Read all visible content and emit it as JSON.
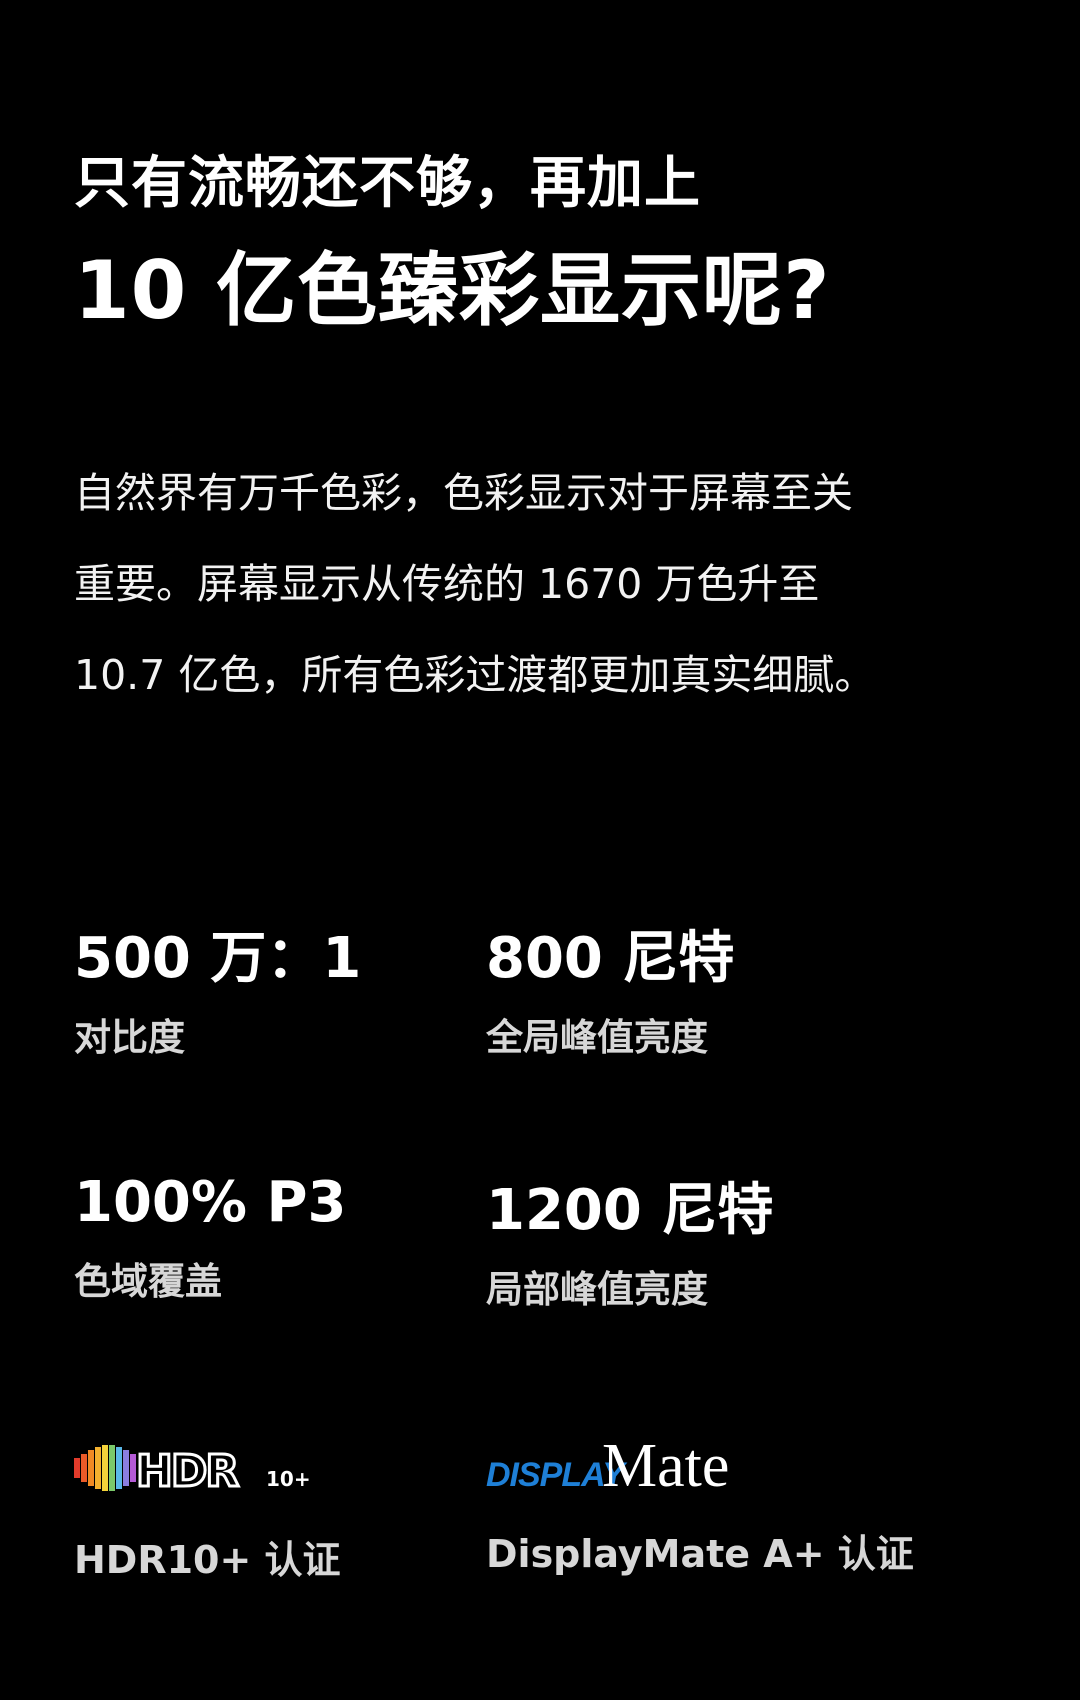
{
  "headline": {
    "line1": "只有流畅还不够，再加上",
    "line2": "10 亿色臻彩显示呢?"
  },
  "body_lines": [
    "自然界有万千色彩，色彩显示对于屏幕至关",
    "重要。屏幕显示从传统的 1670 万色升至",
    "10.7 亿色，所有色彩过渡都更加真实细腻。"
  ],
  "specs": [
    {
      "value": "500 万：1",
      "label": "对比度"
    },
    {
      "value": "800 尼特",
      "label": "全局峰值亮度"
    },
    {
      "value": "100% P3",
      "label": "色域覆盖"
    },
    {
      "value": "1200 尼特",
      "label": "局部峰值亮度"
    }
  ],
  "certifications": [
    {
      "logo_text": "HDR",
      "logo_suffix": "10+",
      "label": "HDR10+ 认证",
      "logo_icon": "hdr10plus-logo"
    },
    {
      "logo_text_blue": "DISPLAY",
      "logo_text_white": "Mate",
      "label": "DisplayMate A+ 认证",
      "logo_icon": "displaymate-logo"
    }
  ],
  "colors": {
    "background": "#000000",
    "text_primary": "#ffffff",
    "text_secondary": "#d7d7d7",
    "displaymate_blue": "#1e7fd6"
  }
}
